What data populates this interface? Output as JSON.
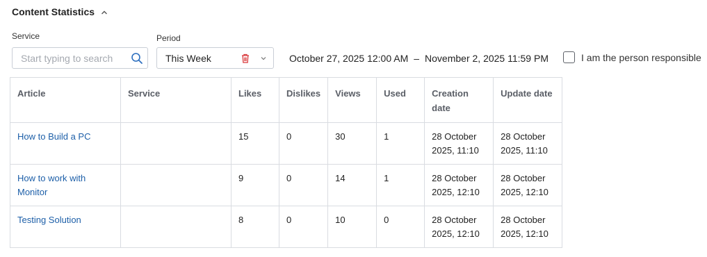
{
  "header": {
    "title": "Content Statistics",
    "collapse_icon": "chevron-up-icon"
  },
  "filters": {
    "service_label": "Service",
    "search_placeholder": "Start typing to search",
    "search_icon": "search-icon",
    "period_label": "Period",
    "period_value": "This Week",
    "clear_icon": "trash-icon",
    "dropdown_icon": "chevron-down-icon",
    "range_start": "October 27, 2025 12:00 AM",
    "range_separator": "–",
    "range_end": "November 2, 2025 11:59 PM",
    "responsible_label": "I am the person responsible",
    "responsible_checked": false
  },
  "table": {
    "columns": [
      "Article",
      "Service",
      "Likes",
      "Dislikes",
      "Views",
      "Used",
      "Creation date",
      "Update date"
    ],
    "rows": [
      [
        "How to Build a PC",
        "",
        "15",
        "0",
        "30",
        "1",
        "28 October 2025, 11:10",
        "28 October 2025, 11:10"
      ],
      [
        "How to work with Monitor",
        "",
        "9",
        "0",
        "14",
        "1",
        "28 October 2025, 12:10",
        "28 October 2025, 12:10"
      ],
      [
        "Testing Solution",
        "",
        "8",
        "0",
        "10",
        "0",
        "28 October 2025, 12:10",
        "28 October 2025, 12:10"
      ]
    ]
  },
  "colors": {
    "link": "#1d5fa8",
    "trash": "#d9383a",
    "search_icon": "#2d6fbf"
  }
}
